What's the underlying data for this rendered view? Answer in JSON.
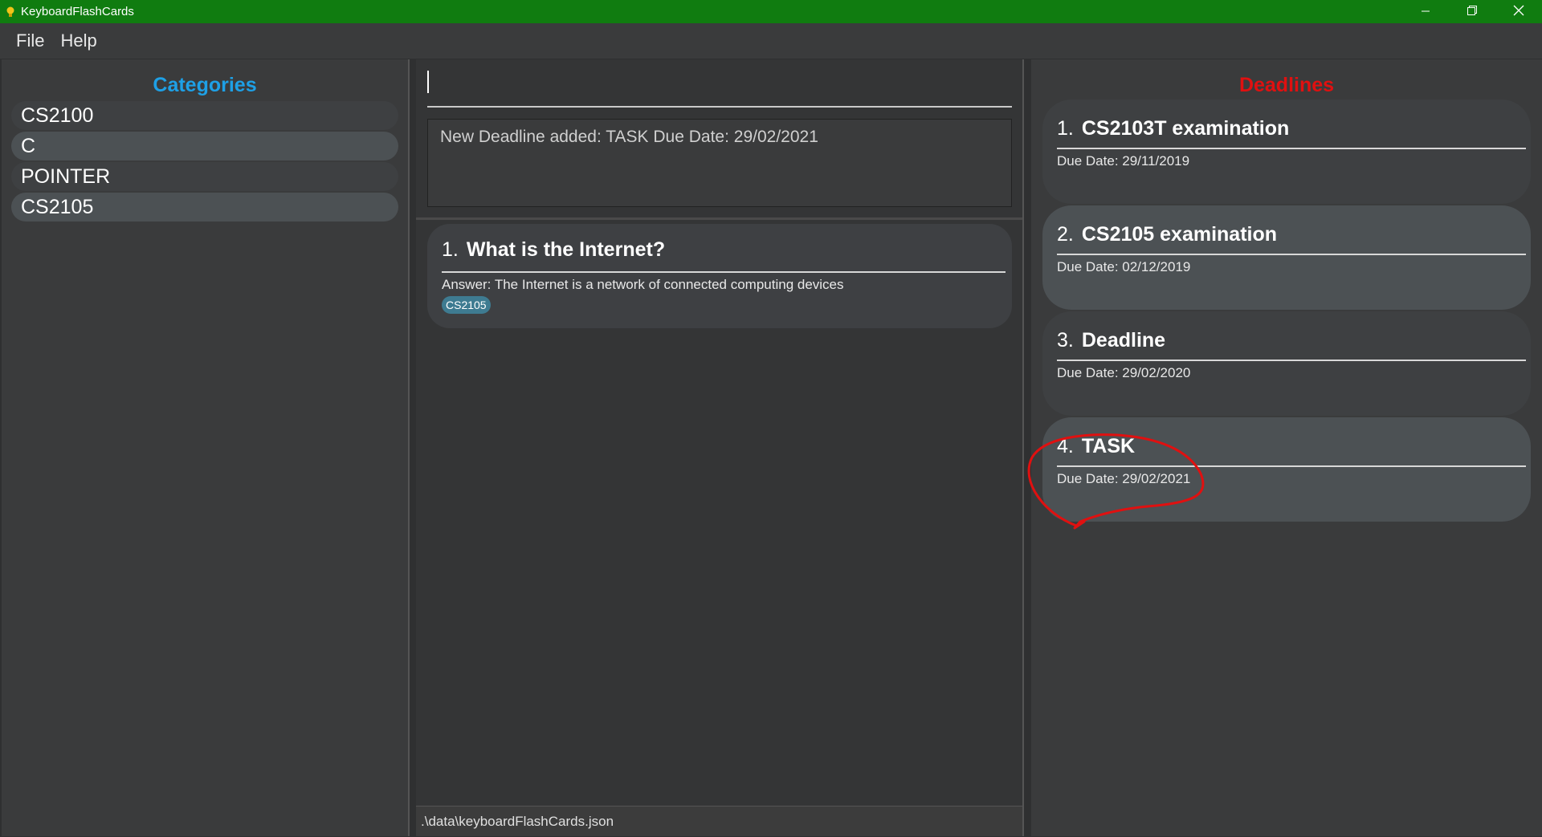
{
  "window": {
    "title": "KeyboardFlashCards",
    "controls": {
      "minimize_icon": "minimize-icon",
      "restore_icon": "restore-icon",
      "close_icon": "close-icon"
    }
  },
  "menu": {
    "file": "File",
    "help": "Help"
  },
  "categories": {
    "title": "Categories",
    "items": [
      "CS2100",
      "C",
      "POINTER",
      "CS2105"
    ]
  },
  "command": {
    "value": "",
    "placeholder": ""
  },
  "result": {
    "text": "New Deadline added: TASK Due Date: 29/02/2021"
  },
  "flashcards": [
    {
      "index": "1.",
      "question": "What is the Internet?",
      "answer": "Answer: The Internet is a network of connected computing devices",
      "tag": "CS2105"
    }
  ],
  "status": {
    "path": ".\\data\\keyboardFlashCards.json"
  },
  "deadlines": {
    "title": "Deadlines",
    "items": [
      {
        "index": "1.",
        "name": "CS2103T examination",
        "due": "Due Date: 29/11/2019"
      },
      {
        "index": "2.",
        "name": "CS2105 examination",
        "due": "Due Date: 02/12/2019"
      },
      {
        "index": "3.",
        "name": "Deadline",
        "due": "Due Date: 29/02/2020"
      },
      {
        "index": "4.",
        "name": "TASK",
        "due": "Due Date: 29/02/2021"
      }
    ]
  },
  "colors": {
    "titlebar": "#107c10",
    "categories_title": "#1ea0e6",
    "deadlines_title": "#e01010",
    "tag": "#3e7b91",
    "annotation": "#e01010"
  }
}
